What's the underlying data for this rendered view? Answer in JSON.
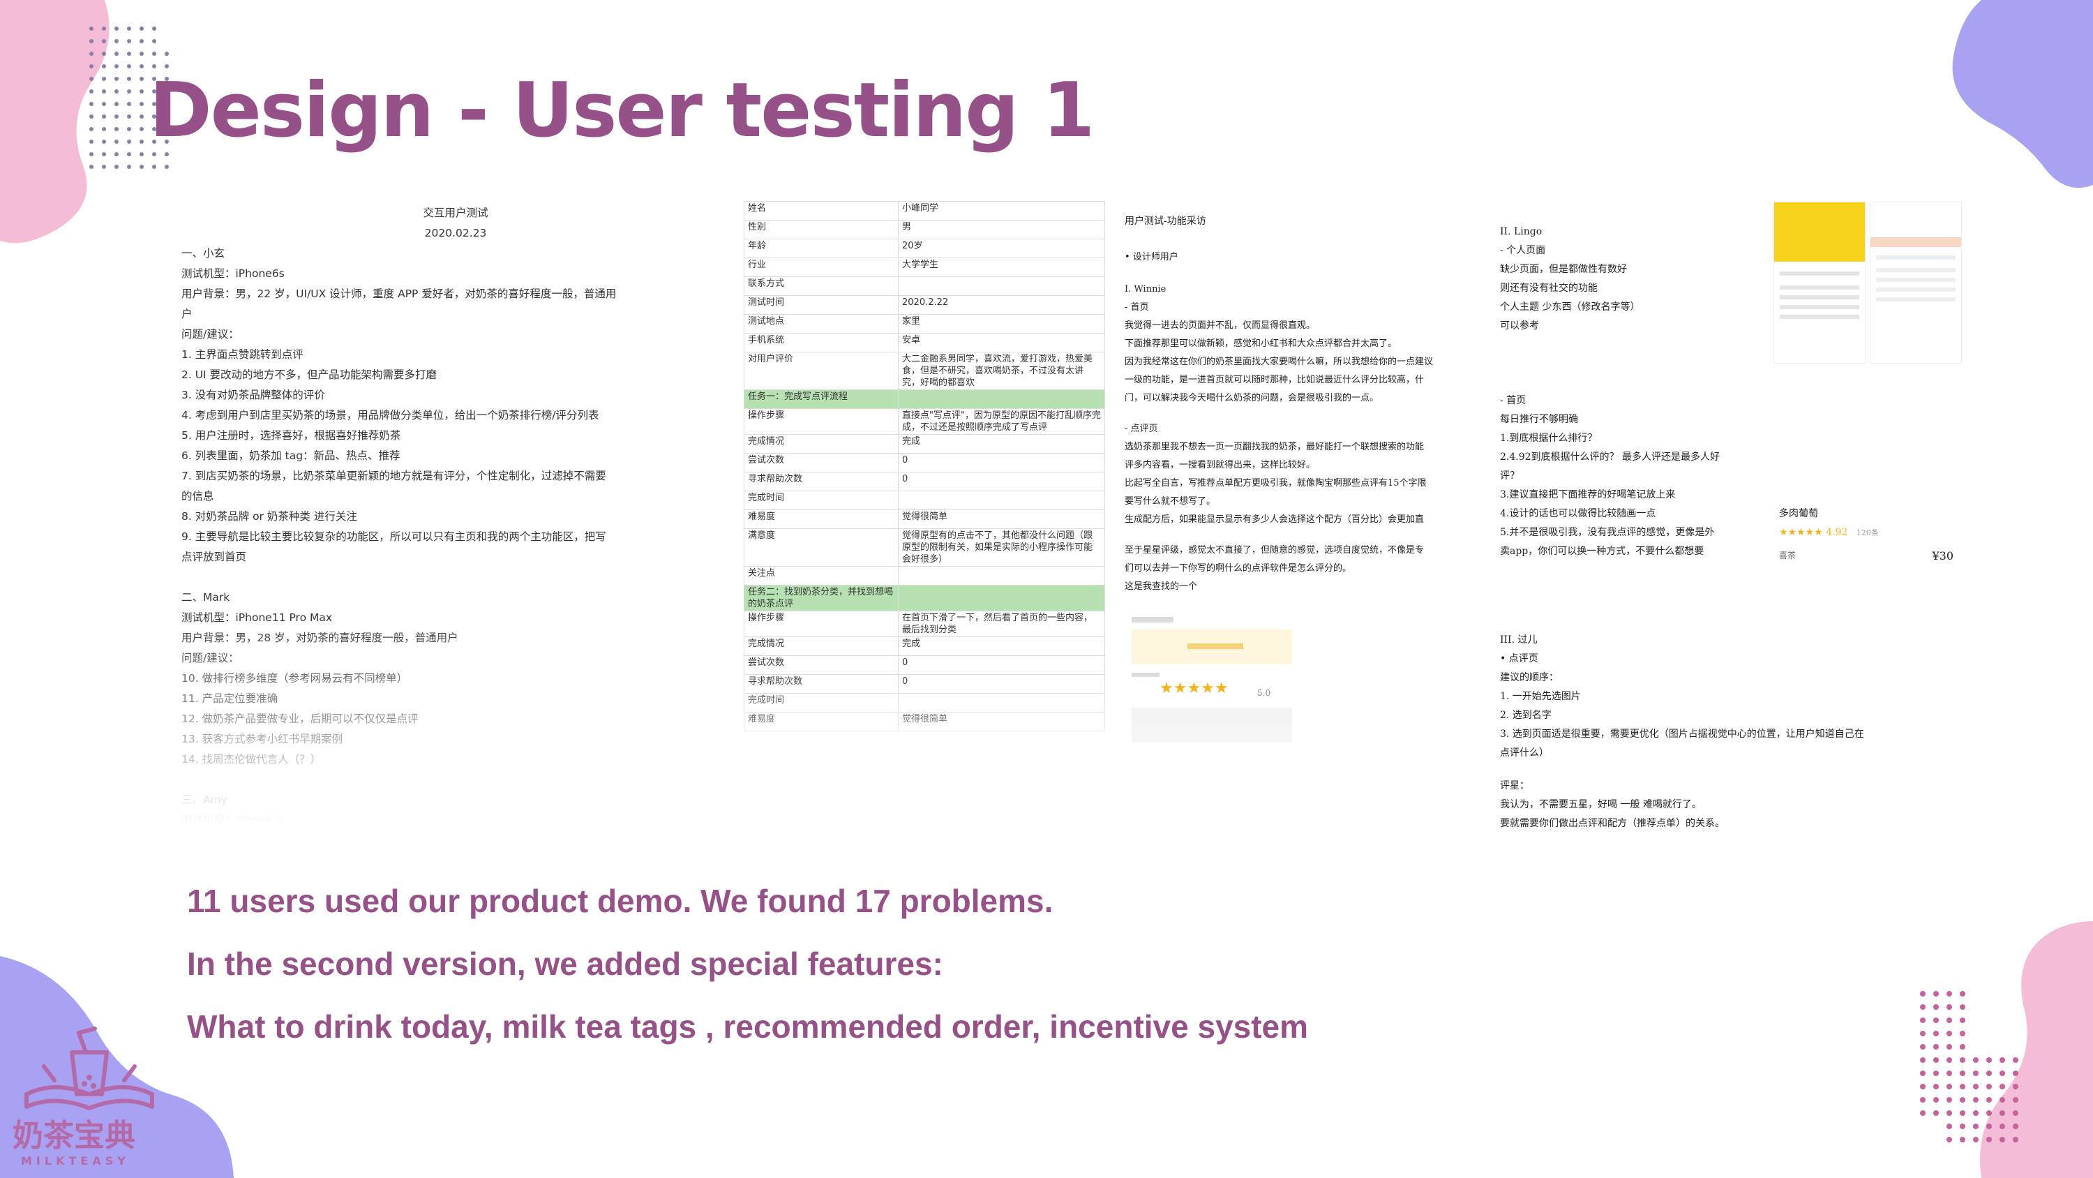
{
  "title": "Design - User testing 1",
  "captions": [
    "11 users used our product demo. We found 17 problems.",
    "In the second version, we added special features:",
    "What to drink today, milk tea tags , recommended order, incentive system"
  ],
  "colors": {
    "title": "#965189",
    "pink_blob": "#f4bcd6",
    "purple_blob": "#a9a2f2",
    "dots": "#8b7fa8",
    "pink_dots": "#c4639c"
  },
  "logo": {
    "chinese": "奶茶宝典",
    "english": "MILKTEASY"
  },
  "doc1": {
    "heading": "交互用户测试",
    "date": "2020.02.23",
    "lines": [
      "一、小玄",
      "测试机型：iPhone6s",
      "用户背景：男，22 岁，UI/UX 设计师，重度 APP 爱好者，对奶茶的喜好程度一般，普通用",
      "户",
      "问题/建议：",
      "1.  主界面点赞跳转到点评",
      "2.  UI 要改动的地方不多，但产品功能架构需要多打磨",
      "3.  没有对奶茶品牌整体的评价",
      "4.  考虑到用户到店里买奶茶的场景，用品牌做分类单位，给出一个奶茶排行榜/评分列表",
      "5.  用户注册时，选择喜好，根据喜好推荐奶茶",
      "6.  列表里面，奶茶加 tag：新品、热点、推荐",
      "7.  到店买奶茶的场景，比奶茶菜单更新颖的地方就是有评分，个性定制化，过滤掉不需要",
      "     的信息",
      "8.  对奶茶品牌 or 奶茶种类 进行关注",
      "9.  主要导航是比较主要比较复杂的功能区，所以可以只有主页和我的两个主功能区，把写",
      "     点评放到首页",
      "",
      "二、Mark",
      "测试机型：iPhone11 Pro Max",
      "用户背景：男，28 岁，对奶茶的喜好程度一般，普通用户",
      "问题/建议：",
      "10. 做排行榜多维度（参考网易云有不同榜单）",
      "11. 产品定位要准确",
      "12. 做奶茶产品要做专业，后期可以不仅仅是点评",
      "13. 获客方式参考小红书早期案例",
      "14. 找周杰伦做代言人（？）",
      "",
      "三、Amy",
      "测试机型：iPhone 7"
    ]
  },
  "form": {
    "rows": [
      {
        "k": "姓名",
        "v": "小峰同学"
      },
      {
        "k": "性别",
        "v": "男"
      },
      {
        "k": "年龄",
        "v": "20岁"
      },
      {
        "k": "行业",
        "v": "大学学生"
      },
      {
        "k": "联系方式",
        "v": ""
      },
      {
        "k": "测试时间",
        "v": "2020.2.22"
      },
      {
        "k": "测试地点",
        "v": "家里"
      },
      {
        "k": "手机系统",
        "v": "安卓"
      },
      {
        "k": "对用户评价",
        "v": "大二金融系男同学，喜欢流，爱打游戏，热爱美食，但是不研究，喜欢喝奶茶，不过没有太讲究，好喝的都喜欢"
      },
      {
        "k": "任务一：完成写点评流程",
        "v": "",
        "green": true
      },
      {
        "k": "操作步骤",
        "v": "直接点\"写点评\"，因为原型的原因不能打乱顺序完成，不过还是按照顺序完成了写点评"
      },
      {
        "k": "完成情况",
        "v": "完成"
      },
      {
        "k": "尝试次数",
        "v": "0"
      },
      {
        "k": "寻求帮助次数",
        "v": "0"
      },
      {
        "k": "完成时间",
        "v": ""
      },
      {
        "k": "难易度",
        "v": "觉得很简单"
      },
      {
        "k": "满意度",
        "v": "觉得原型有的点击不了，其他都没什么问题（跟原型的限制有关，如果是实际的小程序操作可能会好很多）"
      },
      {
        "k": "关注点",
        "v": ""
      },
      {
        "k": "任务二：找到奶茶分类，并找到想喝的奶茶点评",
        "v": "",
        "green": true
      },
      {
        "k": "操作步骤",
        "v": "在首页下滑了一下，然后看了首页的一些内容，最后找到分类"
      },
      {
        "k": "完成情况",
        "v": "完成"
      },
      {
        "k": "尝试次数",
        "v": "0"
      },
      {
        "k": "寻求帮助次数",
        "v": "0"
      },
      {
        "k": "完成时间",
        "v": ""
      },
      {
        "k": "难易度",
        "v": "觉得很简单"
      }
    ]
  },
  "doc3": {
    "title": "用户测试-功能采访",
    "bullet": "• 设计师用户",
    "section": "I.  Winnie",
    "home": "- 首页",
    "lines_a": [
      "我觉得一进去的页面并不乱，仅而显得很直观。",
      "下面推荐那里可以做新颖，感觉和小红书和大众点评都合并太高了。",
      "因为我经常这在你们的奶茶里面找大家要喝什么嘛，所以我想给你的一点建议",
      "一级的功能，是一进首页就可以随时那种，比如说最近什么评分比较高，什",
      "门，可以解决我今天喝什么奶茶的问题，会是很吸引我的一点。"
    ],
    "review": "- 点评页",
    "lines_b": [
      "选奶茶那里我不想去一页一页翻找我的奶茶，最好能打一个联想搜索的功能",
      "评多内容看，一搜看到就得出来，这样比较好。",
      "比起写全自言，写推荐点单配方更吸引我，就像陶宝啊那些点评有15个字限",
      "要写什么就不想写了。",
      "生成配方后，如果能显示显示有多少人会选择这个配方（百分比）会更加直"
    ],
    "lines_c": [
      "至于星星评级，感觉太不直接了，但随意的感觉，选项自度觉统，不像是专",
      "们可以去并一下你写的啊什么的点评软件是怎么评分的。",
      "这是我查找的一个"
    ],
    "rating": "5.0"
  },
  "doc4": {
    "section": "II.  Lingo",
    "lines_a": [
      "- 个人页面",
      "缺少页面，但是都做性有数好",
      "则还有没有社交的功能",
      "个人主题 少东西（修改名字等）",
      "可以参考"
    ],
    "home": "- 首页",
    "lines_b": [
      "每日推行不够明确",
      "1.到底根据什么排行？",
      "2.4.92到底根据什么评的？ 最多人评还是最多人好",
      "评？",
      "3.建议直接把下面推荐的好喝笔记放上来",
      "4.设计的话也可以做得比较随画一点",
      "5.并不是很吸引我，没有我点评的感觉，更像是外",
      "卖app，你们可以换一种方式，不要什么都想要"
    ],
    "product_name": "多肉葡萄",
    "product_rating": "4.92",
    "product_count": "120条",
    "product_label": "喜茶",
    "product_price": "¥30",
    "section3": "III.  过儿",
    "lines_c": [
      "•   点评页",
      "建议的顺序：",
      "1.      一开始先选图片",
      "2.      选到名字",
      "3.      选到页面适是很重要，需要更优化（图片占据视觉中心的位置，让用户知道自己在",
      "         点评什么）"
    ],
    "lines_d": [
      "评星：",
      "我认为，不需要五星，好喝 一般 难喝就行了。",
      "要就需要你们做出点评和配方（推荐点单）的关系。"
    ]
  }
}
